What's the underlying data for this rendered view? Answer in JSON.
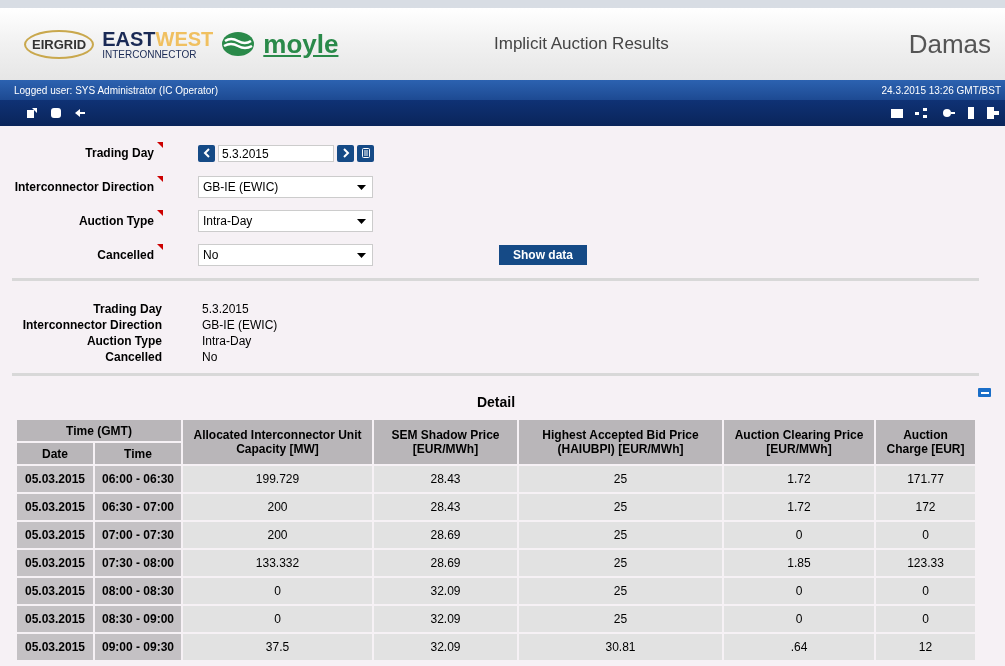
{
  "header": {
    "logos": {
      "eirgrid": "EIRGRID",
      "eastwest_top_dark": "EAST",
      "eastwest_top_light": "WEST",
      "eastwest_bottom": "INTERCONNECTOR",
      "moyle": "moyle"
    },
    "title": "Implicit Auction Results",
    "brand": "Damas"
  },
  "user_bar": {
    "user": "Logged user: SYS Administrator (IC Operator)",
    "datetime": "24.3.2015 13:26 GMT/BST"
  },
  "form": {
    "trading_day": {
      "label": "Trading Day",
      "value": "5.3.2015"
    },
    "fields": [
      {
        "label": "Interconnector Direction",
        "value": "GB-IE (EWIC)"
      },
      {
        "label": "Auction Type",
        "value": "Intra-Day"
      },
      {
        "label": "Cancelled",
        "value": "No"
      }
    ],
    "button": "Show data"
  },
  "summary": [
    {
      "label": "Trading Day",
      "value": "5.3.2015"
    },
    {
      "label": "Interconnector Direction",
      "value": "GB-IE (EWIC)"
    },
    {
      "label": "Auction Type",
      "value": "Intra-Day"
    },
    {
      "label": "Cancelled",
      "value": "No"
    }
  ],
  "table": {
    "title": "Detail",
    "column_group": "Time (GMT)",
    "columns": [
      {
        "label": "Date",
        "in_group": true
      },
      {
        "label": "Time",
        "in_group": true
      },
      {
        "label": "Allocated Interconnector Unit Capacity [MW]",
        "in_group": false
      },
      {
        "label": "SEM Shadow Price [EUR/MWh]",
        "in_group": false
      },
      {
        "label": "Highest Accepted Bid Price (HAIUBPI) [EUR/MWh]",
        "in_group": false
      },
      {
        "label": "Auction Clearing Price [EUR/MWh]",
        "in_group": false
      },
      {
        "label": "Auction Charge [EUR]",
        "in_group": false
      }
    ],
    "rows": [
      [
        "05.03.2015",
        "06:00 - 06:30",
        "199.729",
        "28.43",
        "25",
        "1.72",
        "171.77"
      ],
      [
        "05.03.2015",
        "06:30 - 07:00",
        "200",
        "28.43",
        "25",
        "1.72",
        "172"
      ],
      [
        "05.03.2015",
        "07:00 - 07:30",
        "200",
        "28.69",
        "25",
        "0",
        "0"
      ],
      [
        "05.03.2015",
        "07:30 - 08:00",
        "133.332",
        "28.69",
        "25",
        "1.85",
        "123.33"
      ],
      [
        "05.03.2015",
        "08:00 - 08:30",
        "0",
        "32.09",
        "25",
        "0",
        "0"
      ],
      [
        "05.03.2015",
        "08:30 - 09:00",
        "0",
        "32.09",
        "25",
        "0",
        "0"
      ],
      [
        "05.03.2015",
        "09:00 - 09:30",
        "37.5",
        "32.09",
        "30.81",
        ".64",
        "12"
      ]
    ]
  }
}
